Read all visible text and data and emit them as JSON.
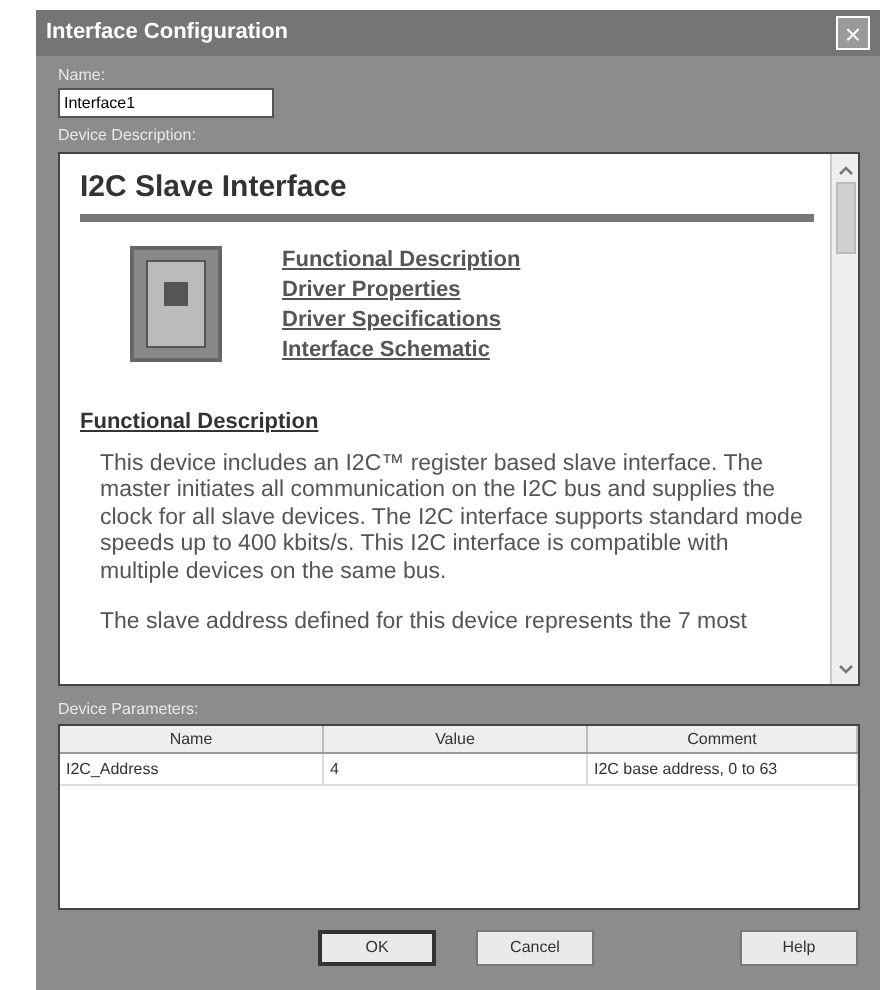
{
  "window": {
    "title": "Interface Configuration",
    "close": "×"
  },
  "name_field": {
    "label": "Name:",
    "value": "Interface1"
  },
  "description": {
    "label": "Device Description:",
    "heading": "I2C Slave Interface",
    "links": [
      "Functional Description",
      "Driver Properties",
      "Driver Specifications",
      "Interface Schematic"
    ],
    "section_heading": "Functional Description",
    "paragraphs": [
      "This device includes an I2C™ register based slave interface. The master initiates all communication on the I2C bus and supplies the clock for all slave devices. The I2C interface supports standard mode speeds up to 400 kbits/s. This I2C interface is compatible with multiple devices on the same bus.",
      "The slave address defined for this device represents the 7 most"
    ]
  },
  "parameters": {
    "label": "Device Parameters:",
    "columns": [
      "Name",
      "Value",
      "Comment"
    ],
    "rows": [
      [
        "I2C_Address",
        "4",
        "I2C base address, 0 to 63"
      ]
    ]
  },
  "buttons": [
    {
      "label": "OK",
      "default": true
    },
    {
      "label": "Cancel",
      "default": false
    },
    {
      "label": "Help",
      "default": false
    }
  ]
}
